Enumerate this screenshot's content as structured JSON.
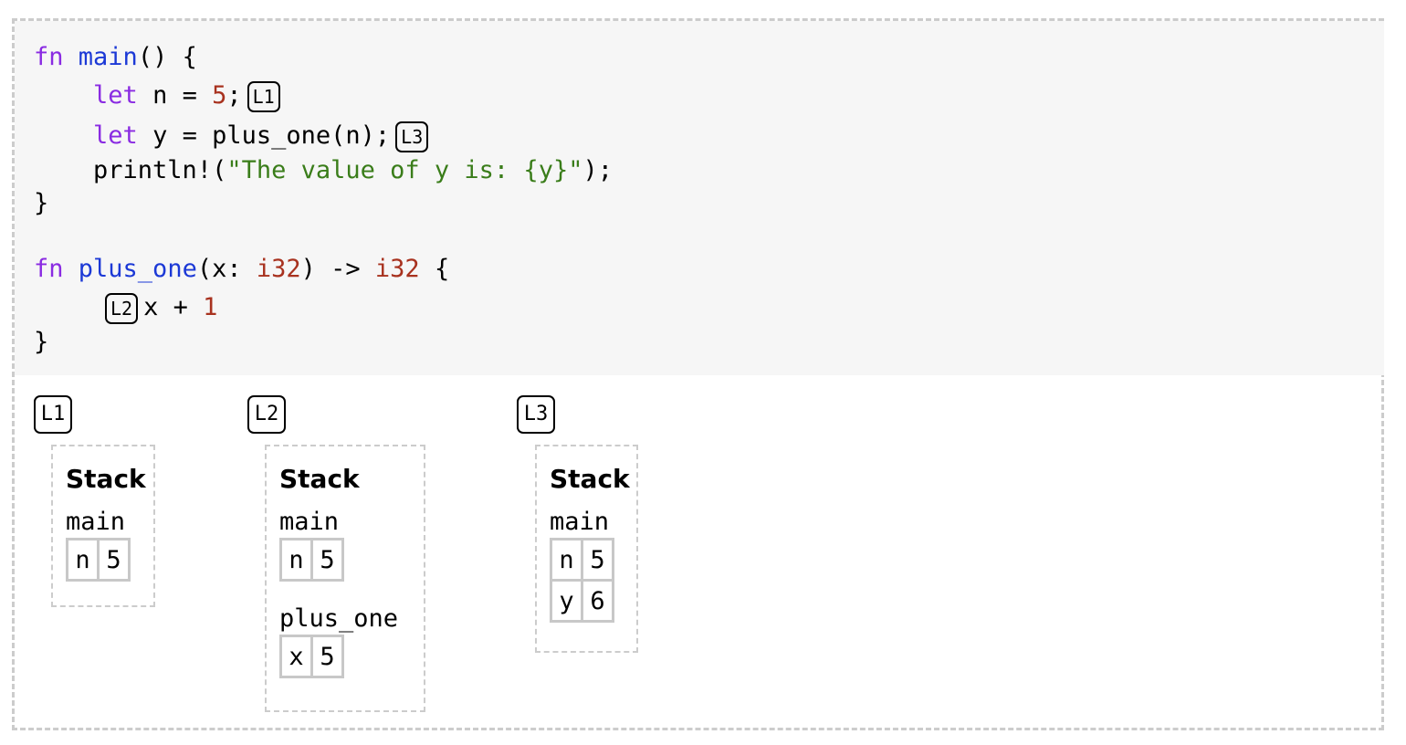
{
  "code": {
    "lines": [
      {
        "tokens": [
          "fn",
          " ",
          "main",
          "() {"
        ]
      },
      {
        "tokens": [
          "    ",
          "let",
          " n = ",
          "5",
          ";"
        ]
      },
      {
        "tokens": [
          "    ",
          "let",
          " y = plus_one(n);"
        ]
      },
      {
        "tokens": [
          "    println!(",
          "\"The value of y is: {y}\"",
          ");"
        ]
      },
      {
        "tokens": [
          "}"
        ]
      },
      {
        "tokens": [
          "fn",
          " ",
          "plus_one",
          "(x: ",
          "i32",
          ") -> ",
          "i32",
          " {"
        ]
      },
      {
        "tokens": [
          "x + ",
          "1"
        ]
      },
      {
        "tokens": [
          "}"
        ]
      }
    ],
    "inline_labels": [
      "L1",
      "L3",
      "L2"
    ]
  },
  "steps": [
    {
      "label": "L1",
      "stack_title": "Stack",
      "frames": [
        {
          "name": "main",
          "vars": [
            {
              "name": "n",
              "value": "5"
            }
          ]
        }
      ]
    },
    {
      "label": "L2",
      "stack_title": "Stack",
      "frames": [
        {
          "name": "main",
          "vars": [
            {
              "name": "n",
              "value": "5"
            }
          ]
        },
        {
          "name": "plus_one",
          "vars": [
            {
              "name": "x",
              "value": "5"
            }
          ]
        }
      ]
    },
    {
      "label": "L3",
      "stack_title": "Stack",
      "frames": [
        {
          "name": "main",
          "vars": [
            {
              "name": "n",
              "value": "5"
            },
            {
              "name": "y",
              "value": "6"
            }
          ]
        }
      ]
    }
  ],
  "colors": {
    "keyword": "#8a2be2",
    "function": "#1c39d6",
    "number": "#a8321f",
    "string": "#3a7d1a",
    "border": "#cccccc",
    "code_bg": "#f6f6f6"
  }
}
